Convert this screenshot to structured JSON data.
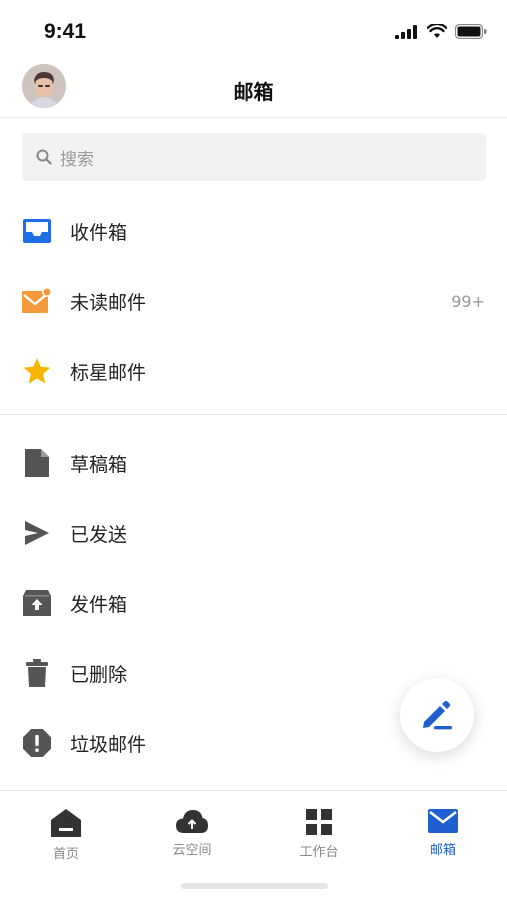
{
  "status_bar": {
    "time": "9:41"
  },
  "header": {
    "title": "邮箱"
  },
  "search": {
    "placeholder": "搜索"
  },
  "primary_folders": [
    {
      "label": "收件箱",
      "icon": "inbox-icon"
    },
    {
      "label": "未读邮件",
      "icon": "unread-mail-icon",
      "count": "99+"
    },
    {
      "label": "标星邮件",
      "icon": "star-icon"
    }
  ],
  "secondary_folders": [
    {
      "label": "草稿箱",
      "icon": "draft-icon"
    },
    {
      "label": "已发送",
      "icon": "send-icon"
    },
    {
      "label": "发件箱",
      "icon": "outbox-icon"
    },
    {
      "label": "已删除",
      "icon": "trash-icon"
    },
    {
      "label": "垃圾邮件",
      "icon": "spam-icon"
    }
  ],
  "tabs": [
    {
      "label": "首页",
      "icon": "home-icon"
    },
    {
      "label": "云空间",
      "icon": "cloud-icon"
    },
    {
      "label": "工作台",
      "icon": "workbench-icon"
    },
    {
      "label": "邮箱",
      "icon": "mail-icon",
      "active": true
    }
  ],
  "colors": {
    "accent": "#1f5fcf",
    "inbox_blue": "#1e6fe6",
    "unread_orange": "#f59a3c",
    "star_yellow": "#f7b500",
    "icon_gray": "#555555"
  }
}
